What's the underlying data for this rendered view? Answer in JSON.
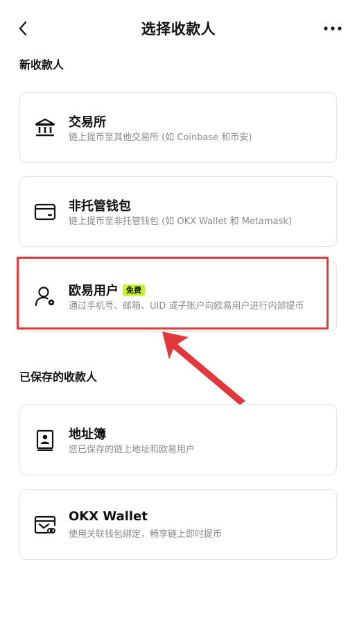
{
  "header": {
    "title": "选择收款人",
    "back_icon": "chevron-left-icon",
    "more_icon": "more-horizontal-icon"
  },
  "sections": {
    "new_title": "新收款人",
    "saved_title": "已保存的收款人"
  },
  "new_payees": [
    {
      "name": "交易所",
      "desc": "链上提币至其他交易所 (如 Coinbase 和币安)",
      "icon": "bank-icon"
    },
    {
      "name": "非托管钱包",
      "desc": "链上提币至非托管钱包 (如 OKX Wallet 和 Metamask)",
      "icon": "wallet-icon"
    },
    {
      "name": "欧易用户",
      "badge": "免费",
      "desc": "通过手机号、邮箱、UID 或子账户向欧易用户进行内部提币",
      "icon": "user-icon"
    }
  ],
  "saved_payees": [
    {
      "name": "地址簿",
      "desc": "您已保存的链上地址和欧易用户",
      "icon": "address-book-icon"
    },
    {
      "name": "OKX Wallet",
      "desc": "使用关联钱包绑定，畅享链上即时提币",
      "icon": "linked-wallet-icon"
    }
  ],
  "colors": {
    "highlight": "#e3373a",
    "badge_bg": "#c6f432",
    "desc_text": "#8a8a8a",
    "card_border": "#e3e3e3"
  }
}
